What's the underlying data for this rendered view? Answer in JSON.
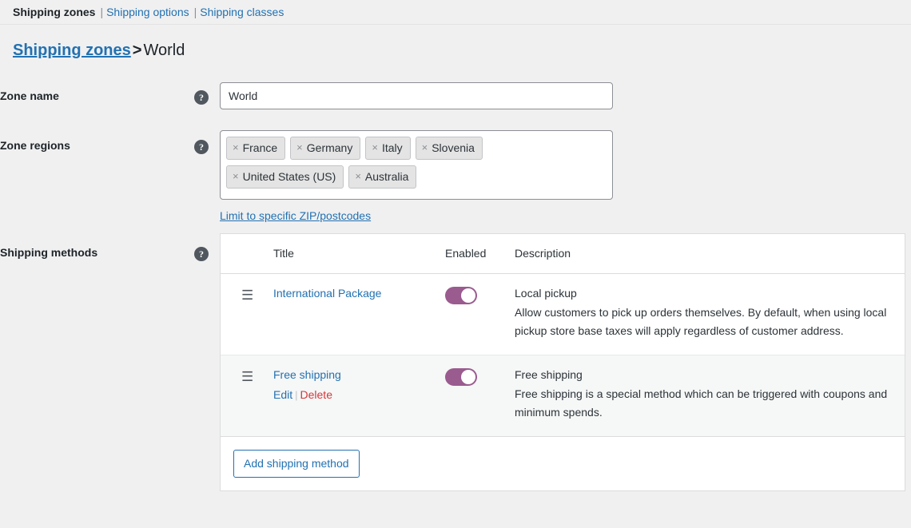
{
  "subnav": {
    "current": "Shipping zones",
    "separator": "|",
    "links": [
      {
        "label": "Shipping options"
      },
      {
        "label": "Shipping classes"
      }
    ]
  },
  "breadcrumb": {
    "root": "Shipping zones",
    "separator": ">",
    "leaf": "World"
  },
  "form": {
    "zone_name": {
      "label": "Zone name",
      "help_icon": "question-mark-icon",
      "value": "World",
      "placeholder": "Zone name"
    },
    "zone_regions": {
      "label": "Zone regions",
      "help_icon": "question-mark-icon",
      "remove_glyph": "×",
      "tokens": [
        {
          "label": "France"
        },
        {
          "label": "Germany"
        },
        {
          "label": "Italy"
        },
        {
          "label": "Slovenia"
        },
        {
          "label": "United States (US)"
        },
        {
          "label": "Australia"
        }
      ],
      "postcode_link": "Limit to specific ZIP/postcodes"
    },
    "shipping_methods": {
      "label": "Shipping methods",
      "help_icon": "question-mark-icon",
      "columns": {
        "sort": "",
        "title": "Title",
        "enabled": "Enabled",
        "description": "Description"
      },
      "rows": [
        {
          "handle_icon": "drag-handle-icon",
          "title": "International Package",
          "enabled": true,
          "actions": null,
          "desc_title": "Local pickup",
          "desc_body": "Allow customers to pick up orders themselves. By default, when using local pickup store base taxes will apply regardless of customer address."
        },
        {
          "handle_icon": "drag-handle-icon",
          "title": "Free shipping",
          "enabled": true,
          "actions": {
            "edit": "Edit",
            "separator": "|",
            "delete": "Delete"
          },
          "desc_title": "Free shipping",
          "desc_body": "Free shipping is a special method which can be triggered with coupons and minimum spends."
        }
      ],
      "add_button": "Add shipping method"
    }
  },
  "colors": {
    "accent_link": "#2271b1",
    "delete": "#d63638",
    "toggle_on": "#9a5b8f",
    "page_bg": "#f0f0f1",
    "panel_border": "#dcdcde"
  }
}
